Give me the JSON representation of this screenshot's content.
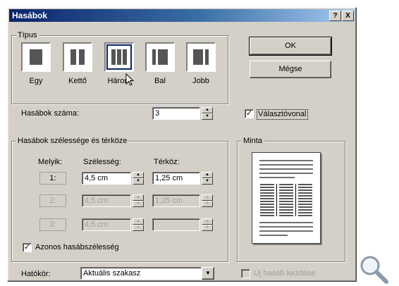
{
  "dialog": {
    "title": "Hasábok",
    "help_glyph": "?",
    "close_glyph": "X"
  },
  "tipus": {
    "legend": "Típus",
    "presets": [
      {
        "label": "Egy",
        "selected": false
      },
      {
        "label": "Kettő",
        "selected": false
      },
      {
        "label": "Három",
        "selected": true
      },
      {
        "label": "Bal",
        "selected": false
      },
      {
        "label": "Jobb",
        "selected": false
      }
    ]
  },
  "buttons": {
    "ok": "OK",
    "cancel": "Mégse"
  },
  "column_count": {
    "label": "Hasábok száma:",
    "value": "3"
  },
  "separator": {
    "label": "Választóvonal",
    "checked": true
  },
  "width_spacing": {
    "legend": "Hasábok szélessége és térköze",
    "headers": {
      "index": "Melyik:",
      "width": "Szélesség:",
      "spacing": "Térköz:"
    },
    "rows": [
      {
        "index": "1:",
        "width": "4,5 cm",
        "spacing": "1,25 cm",
        "enabled": true
      },
      {
        "index": "2:",
        "width": "4,5 cm",
        "spacing": "1,25 cm",
        "enabled": false
      },
      {
        "index": "3:",
        "width": "4,5 cm",
        "spacing": "",
        "enabled": false
      }
    ],
    "equal_width": {
      "label": "Azonos hasábszélesség",
      "checked": true
    }
  },
  "preview": {
    "legend": "Minta"
  },
  "scope": {
    "label": "Hatókör:",
    "value": "Aktuális szakasz"
  },
  "new_column": {
    "label": "Új hasáb kezdése",
    "checked": false,
    "enabled": false
  },
  "icons": {
    "cursor": "mouse-pointer",
    "magnifier": "magnifier"
  }
}
